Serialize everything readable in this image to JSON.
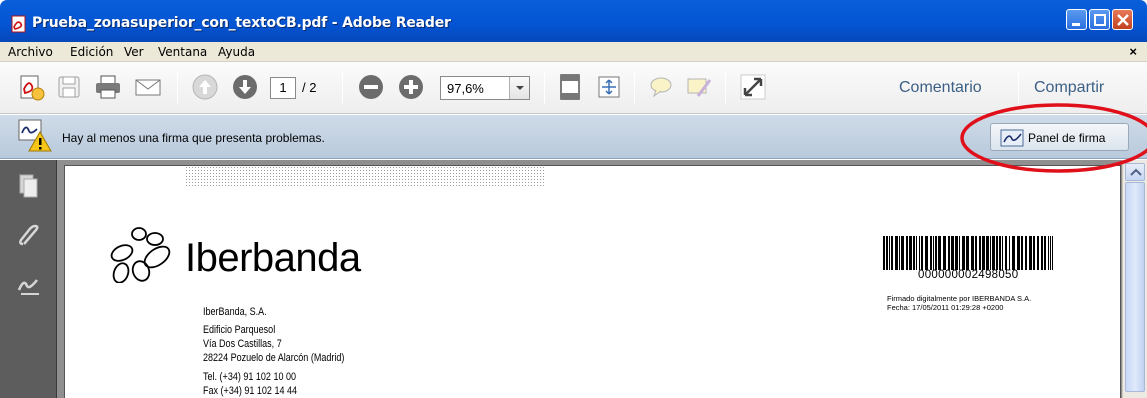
{
  "window": {
    "title": "Prueba_zonasuperior_con_textoCB.pdf - Adobe Reader"
  },
  "menu": {
    "items": [
      "Archivo",
      "Edición",
      "Ver",
      "Ventana",
      "Ayuda"
    ],
    "close_symbol": "×"
  },
  "toolbar": {
    "page_current": "1",
    "page_total": "/ 2",
    "zoom": "97,6%",
    "comment_label": "Comentario",
    "share_label": "Compartir"
  },
  "signature_bar": {
    "message": "Hay al menos una firma que presenta problemas.",
    "panel_button_label": "Panel de firma"
  },
  "document": {
    "logo_text": "Iberbanda",
    "address_lines": [
      "IberBanda, S.A.",
      "Edificio Parquesol",
      "Vía Dos Castillas, 7",
      "28224 Pozuelo de Alarcón (Madrid)"
    ],
    "phone": "Tel. (+34) 91 102 10 00",
    "fax": "Fax (+34) 91 102 14 44",
    "barcode_number": "000000002498050",
    "signed_by": "Firmado digitalmente por IBERBANDA S.A.",
    "signed_date": "Fecha: 17/05/2011 01:29:28 +0200"
  },
  "colors": {
    "titlebar_blue": "#0454d3",
    "signature_bar": "#c4d3e2",
    "annotation_red": "#e0101a",
    "link_blue": "#3c5f85"
  },
  "icons": [
    "pdf-icon",
    "create-pdf-icon",
    "save-icon",
    "print-icon",
    "email-icon",
    "previous-page-icon",
    "next-page-icon",
    "zoom-out-icon",
    "zoom-in-icon",
    "fit-page-icon",
    "fit-width-icon",
    "comment-icon",
    "sign-icon",
    "fullscreen-icon",
    "signature-warning-icon",
    "pages-icon",
    "attachments-icon",
    "signatures-icon"
  ]
}
